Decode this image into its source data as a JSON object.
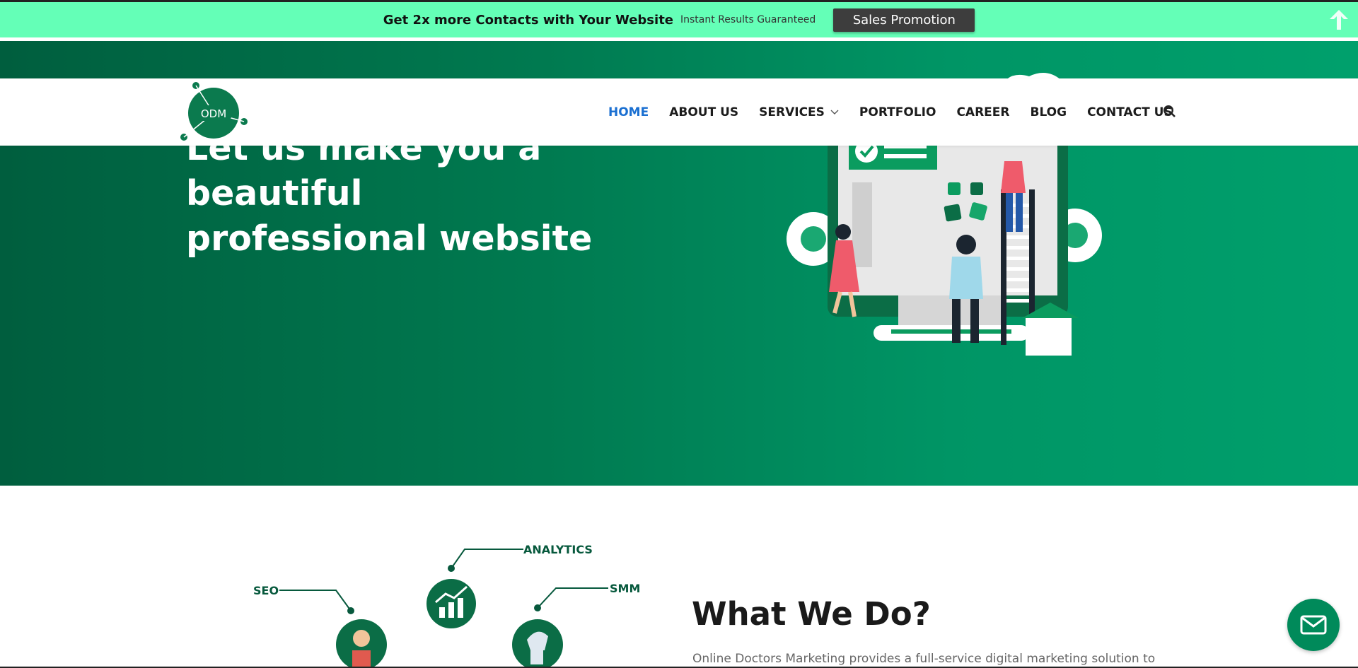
{
  "promo": {
    "headline": "Get 2x more Contacts with Your Website",
    "subtext": "Instant Results Guaranteed",
    "button_label": "Sales Promotion",
    "up_icon": "arrow-up-icon"
  },
  "header": {
    "logo_text": "ODM",
    "nav": [
      {
        "label": "HOME",
        "active": true
      },
      {
        "label": "ABOUT US"
      },
      {
        "label": "SERVICES",
        "has_dropdown": true
      },
      {
        "label": "PORTFOLIO"
      },
      {
        "label": "CAREER"
      },
      {
        "label": "BLOG"
      },
      {
        "label": "CONTACT US"
      }
    ],
    "search_icon": "search-icon"
  },
  "hero": {
    "title_line1": "Let us make you a beautiful",
    "title_line2": "professional website"
  },
  "services": {
    "labels": {
      "seo": "SEO",
      "analytics": "ANALYTICS",
      "smm": "SMM"
    },
    "title": "What We Do?",
    "text": "Online Doctors Marketing provides a full-service digital marketing solution to"
  },
  "fab": {
    "icon": "mail-icon"
  },
  "colors": {
    "promo_bg": "#64ffb7",
    "hero_green": "#009565",
    "nav_active": "#1a6fd1",
    "brand_dark_green": "#07593d"
  }
}
